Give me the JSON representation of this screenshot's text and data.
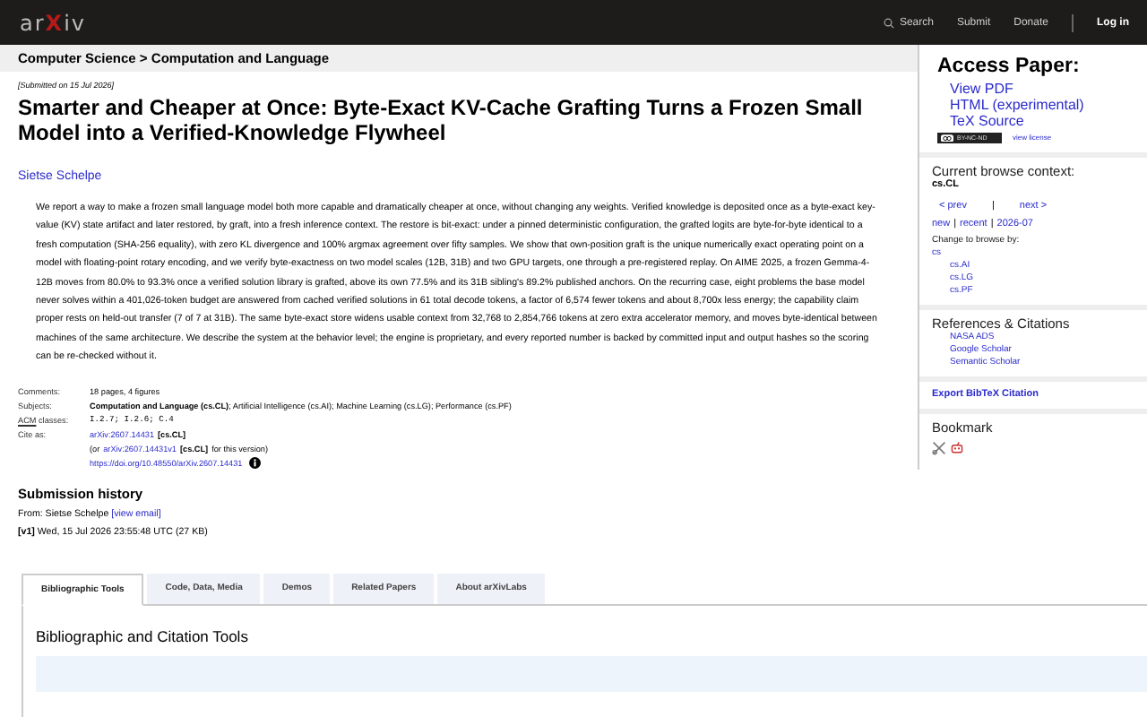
{
  "header": {
    "logo": "arXiv",
    "nav": [
      "Search",
      "Submit",
      "Donate"
    ],
    "login": "Log in"
  },
  "breadcrumb": "Computer Science > Computation and Language",
  "submitted": "[Submitted on 15 Jul 2026]",
  "title": "Smarter and Cheaper at Once: Byte-Exact KV-Cache Grafting Turns a Frozen Small Model into a Verified-Knowledge Flywheel",
  "author": "Sietse Schelpe",
  "abstract": "We report a way to make a frozen small language model both more capable and dramatically cheaper at once, without changing any weights. Verified knowledge is deposited once as a byte-exact key-value (KV) state artifact and later restored, by graft, into a fresh inference context. The restore is bit-exact: under a pinned deterministic configuration, the grafted logits are byte-for-byte identical to a fresh computation (SHA-256 equality), with zero KL divergence and 100% argmax agreement over fifty samples. We show that own-position graft is the unique numerically exact operating point on a model with floating-point rotary encoding, and we verify byte-exactness on two model scales (12B, 31B) and two GPU targets, one through a pre-registered replay. On AIME 2025, a frozen Gemma-4-12B moves from 80.0% to 93.3% once a verified solution library is grafted, above its own 77.5% and its 31B sibling's 89.2% published anchors. On the recurring case, eight problems the base model never solves within a 401,026-token budget are answered from cached verified solutions in 61 total decode tokens, a factor of 6,574 fewer tokens and about 8,700x less energy; the capability claim proper rests on held-out transfer (7 of 7 at 31B). The same byte-exact store widens usable context from 32,768 to 2,854,766 tokens at zero extra accelerator memory, and moves byte-identical between machines of the same architecture. We describe the system at the behavior level; the engine is proprietary, and every reported number is backed by committed input and output hashes so the scoring can be re-checked without it.",
  "metadata": {
    "comments_label": "Comments:",
    "comments": "18 pages, 4 figures",
    "subjects_label": "Subjects:",
    "subjects": "**Computation and Language (cs.CL)**; Artificial Intelligence (cs.AI); Machine Learning (cs.LG); Performance (cs.PF)",
    "acm_label": "ACM",
    "acm_suffix": "classes:",
    "acm": "I.2.7; I.2.6; C.4",
    "cite_label": "Cite as:",
    "cite_id": "arXiv:2607.14431",
    "cite_tag": "[cs.CL]",
    "version_prefix": "(or",
    "version_id": "arXiv:2607.14431v1",
    "version_tag": "[cs.CL]",
    "version_suffix": "for this version)",
    "doi": "https://doi.org/10.48550/arXiv.2607.14431"
  },
  "history": {
    "heading": "Submission history",
    "from": "From: Sietse Schelpe",
    "view_email": "[view email]",
    "version": "[v1]",
    "version_date": "Wed, 15 Jul 2026 23:55:48 UTC (27 KB)"
  },
  "tabs": [
    {
      "label": "Bibliographic Tools",
      "selected": true
    },
    {
      "label": "Code, Data, Media",
      "selected": false
    },
    {
      "label": "Demos",
      "selected": false
    },
    {
      "label": "Related Papers",
      "selected": false
    },
    {
      "label": "About arXivLabs",
      "selected": false
    }
  ],
  "tab_panel": {
    "heading": "Bibliographic and Citation Tools"
  },
  "sidebar": {
    "access_heading": "Access Paper:",
    "access_links": [
      "View PDF",
      "HTML (experimental)",
      "TeX Source"
    ],
    "license_badge": "BY-NC-ND",
    "license_link": "view license",
    "browse_heading": "Current browse context:",
    "browse_context": "cs.CL",
    "prev": "< prev",
    "sep": "|",
    "next": "next >",
    "recent_links": [
      "new",
      "recent",
      "2026-07"
    ],
    "change_heading": "Change to browse by:",
    "browse_by": [
      {
        "label": "cs",
        "children": [
          {
            "label": "cs.AI"
          },
          {
            "label": "cs.LG"
          },
          {
            "label": "cs.PF"
          }
        ]
      }
    ],
    "refs_heading": "References & Citations",
    "refs_links": [
      "NASA ADS",
      "Google Scholar",
      "Semantic Scholar"
    ],
    "export": "Export BibTeX Citation",
    "bookmark_heading": "Bookmark"
  }
}
